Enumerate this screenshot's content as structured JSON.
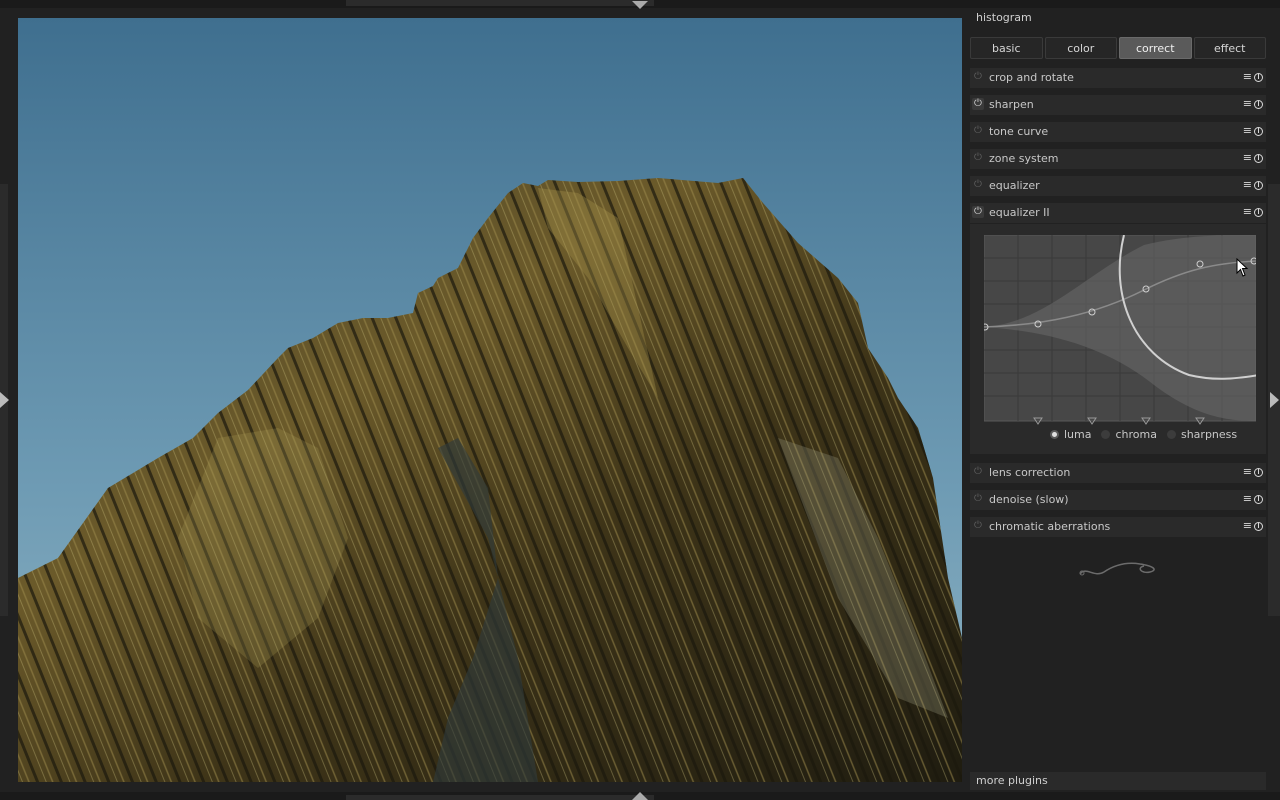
{
  "panel": {
    "histogram_title": "histogram",
    "tabs": [
      {
        "label": "basic"
      },
      {
        "label": "color"
      },
      {
        "label": "correct"
      },
      {
        "label": "effect"
      }
    ],
    "active_tab": "correct",
    "modules": [
      {
        "label": "crop and rotate",
        "enabled": false
      },
      {
        "label": "sharpen",
        "enabled": true
      },
      {
        "label": "tone curve",
        "enabled": false
      },
      {
        "label": "zone system",
        "enabled": false
      },
      {
        "label": "equalizer",
        "enabled": false
      },
      {
        "label": "equalizer II",
        "enabled": true,
        "expanded": true
      },
      {
        "label": "lens correction",
        "enabled": false
      },
      {
        "label": "denoise (slow)",
        "enabled": false
      },
      {
        "label": "chromatic aberrations",
        "enabled": false
      }
    ],
    "equalizer": {
      "modes": [
        {
          "label": "luma",
          "selected": true
        },
        {
          "label": "chroma",
          "selected": false
        },
        {
          "label": "sharpness",
          "selected": false
        }
      ]
    },
    "more_plugins": "more plugins"
  },
  "icons": {
    "power": "power-icon",
    "menu": "menu-icon",
    "reset": "reset-icon"
  },
  "colors": {
    "panel_bg": "#212121",
    "sky": "#5d8aa6",
    "active_tab": "#5a5a5a"
  }
}
